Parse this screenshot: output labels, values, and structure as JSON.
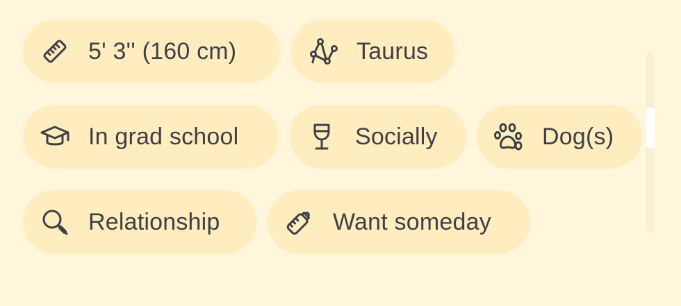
{
  "chips": {
    "height": {
      "label": "5' 3'' (160 cm)",
      "icon": "ruler-icon"
    },
    "zodiac": {
      "label": "Taurus",
      "icon": "constellation-icon"
    },
    "education": {
      "label": "In grad school",
      "icon": "graduation-cap-icon"
    },
    "drinking": {
      "label": "Socially",
      "icon": "wine-glass-icon"
    },
    "pets": {
      "label": "Dog(s)",
      "icon": "paw-icon"
    },
    "looking_for": {
      "label": "Relationship",
      "icon": "search-icon"
    },
    "family_plans": {
      "label": "Want someday",
      "icon": "baby-bottle-icon"
    }
  },
  "colors": {
    "background": "#fff6dc",
    "chip": "#ffedbf",
    "text": "#3f3f46"
  }
}
